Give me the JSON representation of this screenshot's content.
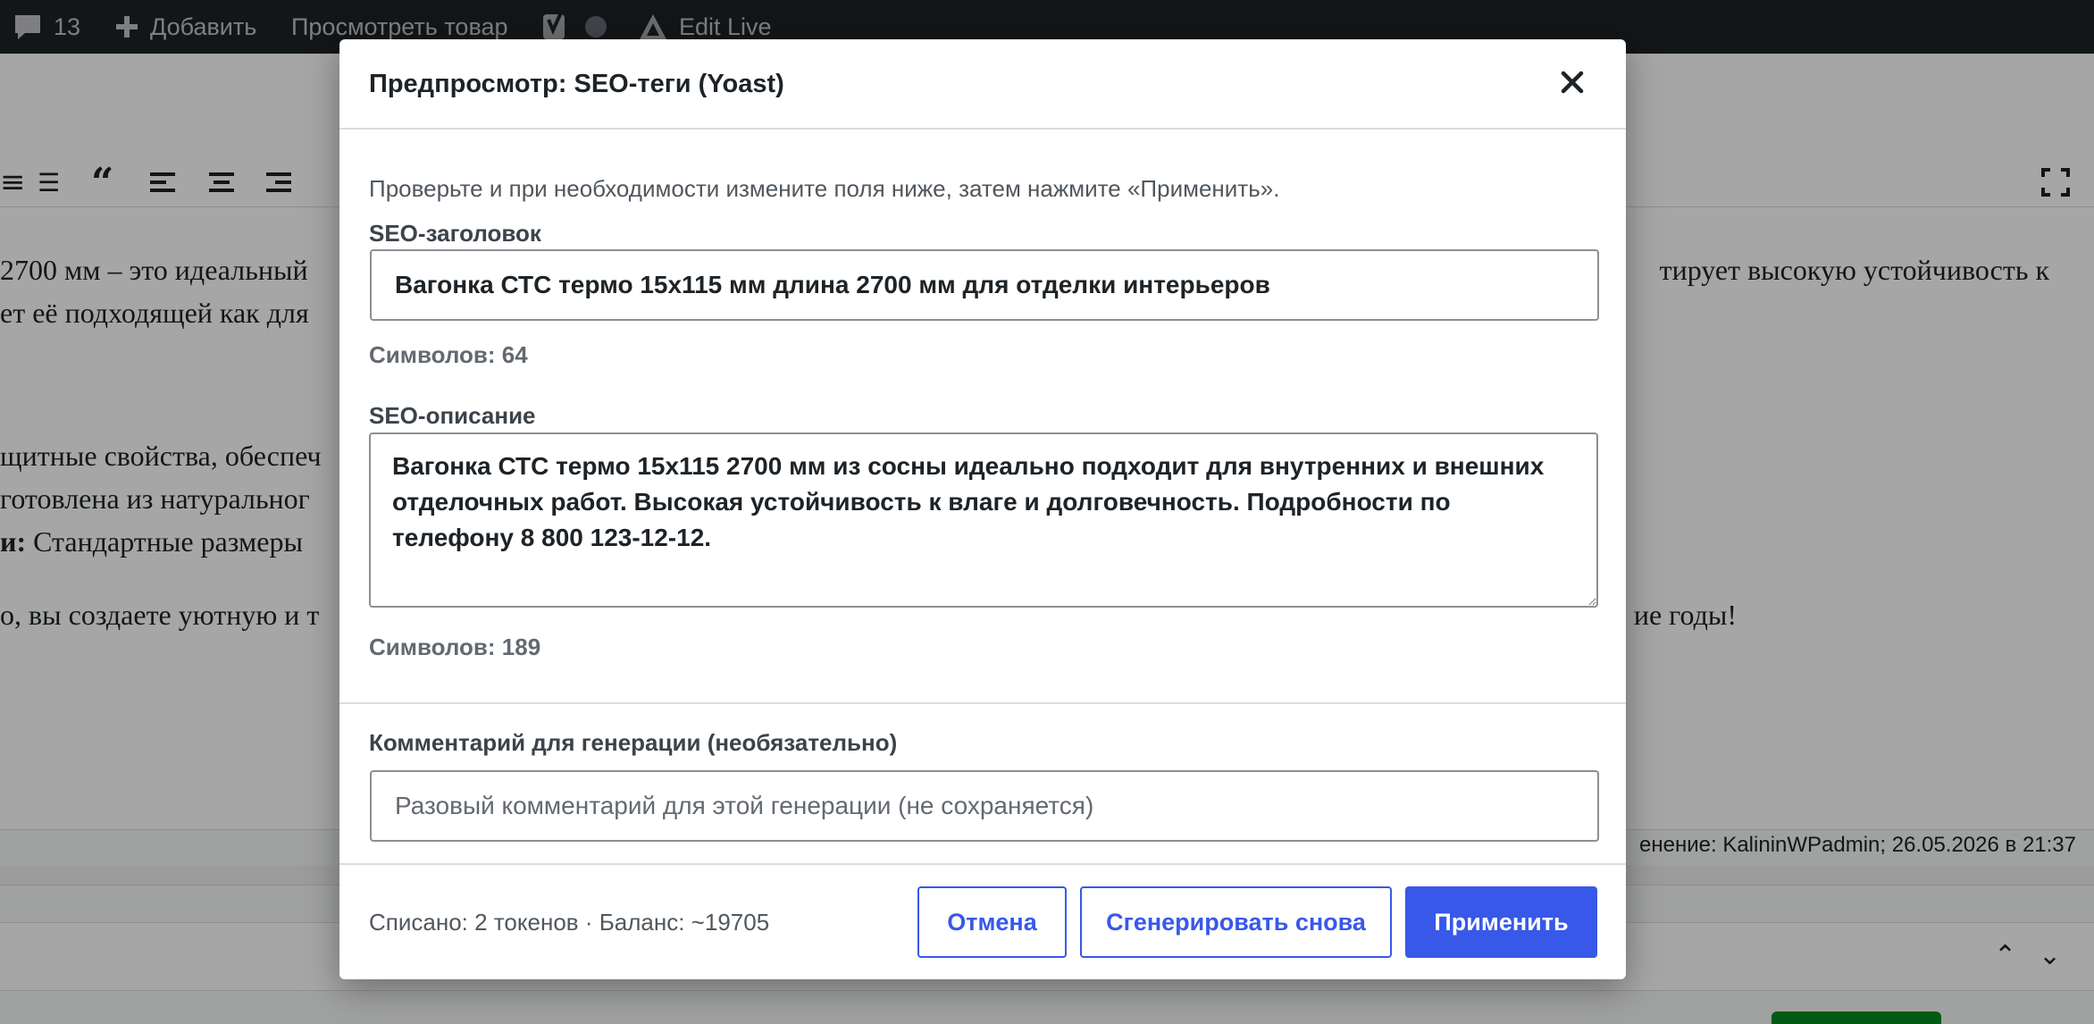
{
  "admin_bar": {
    "comments_count": "13",
    "add_label": "Добавить",
    "view_product_label": "Просмотреть товар",
    "edit_live_label": "Edit Live"
  },
  "background": {
    "line1_left": "2700 мм – это идеальный",
    "line1_right": "тирует высокую устойчивость к",
    "line2_left": "ет её подходящей как для",
    "line3_left": "щитные свойства, обеспеч",
    "line4_left": "готовлена из натуральног",
    "line5_bold": "и:",
    "line5_rest": " Стандартные размеры",
    "line6_left": "о, вы создаете уютную и т",
    "line6_right": "ие годы!",
    "status": "енение: KalininWPadmin; 26.05.2026 в 21:37"
  },
  "modal": {
    "title": "Предпросмотр: SEO-теги (Yoast)",
    "intro": "Проверьте и при необходимости измените поля ниже, затем нажмите «Применить».",
    "seo_title": {
      "label": "SEO-заголовок",
      "value": "Вагонка СТС термо 15х115 мм длина 2700 мм для отделки интерьеров",
      "counter": "Символов: 64"
    },
    "seo_description": {
      "label": "SEO-описание",
      "value": "Вагонка СТС термо 15х115 2700 мм из сосны идеально подходит для внутренних и внешних отделочных работ. Высокая устойчивость к влаге и долговечность. Подробности по телефону 8 800 123-12-12.",
      "counter": "Символов: 189"
    },
    "comment": {
      "label": "Комментарий для генерации (необязательно)",
      "placeholder": "Разовый комментарий для этой генерации (не сохраняется)"
    },
    "footer": {
      "balance": "Списано: 2 токенов · Баланс: ~19705",
      "cancel_label": "Отмена",
      "regenerate_label": "Сгенерировать снова",
      "apply_label": "Применить"
    }
  },
  "colors": {
    "accent": "#3858e9",
    "admin_bar": "#1d2327"
  }
}
